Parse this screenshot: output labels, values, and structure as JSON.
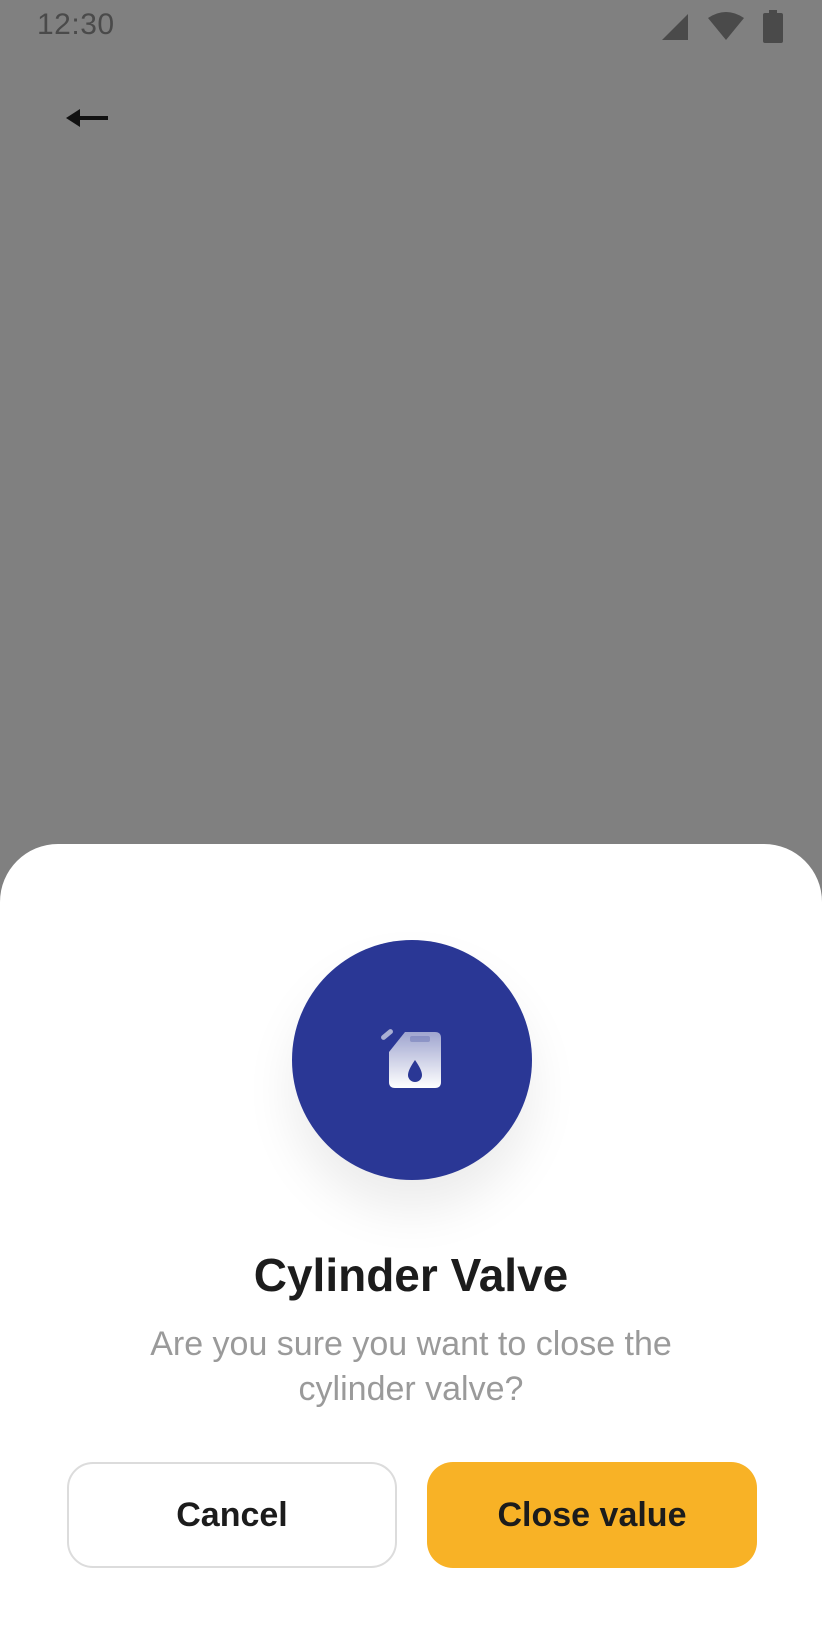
{
  "status_bar": {
    "time": "12:30",
    "icons": [
      "signal-icon",
      "wifi-icon",
      "battery-icon"
    ]
  },
  "nav": {
    "back_icon": "arrow-left-icon"
  },
  "dialog": {
    "icon": "fuel-can-icon",
    "title": "Cylinder Valve",
    "message": "Are you sure you want to close the cylinder valve?",
    "cancel_label": "Cancel",
    "confirm_label": "Close value"
  },
  "colors": {
    "overlay": "#808080",
    "sheet": "#ffffff",
    "icon_circle": "#2a3795",
    "confirm_button": "#f8b226",
    "title_text": "#1c1c1c",
    "message_text": "#9a9a9a"
  }
}
